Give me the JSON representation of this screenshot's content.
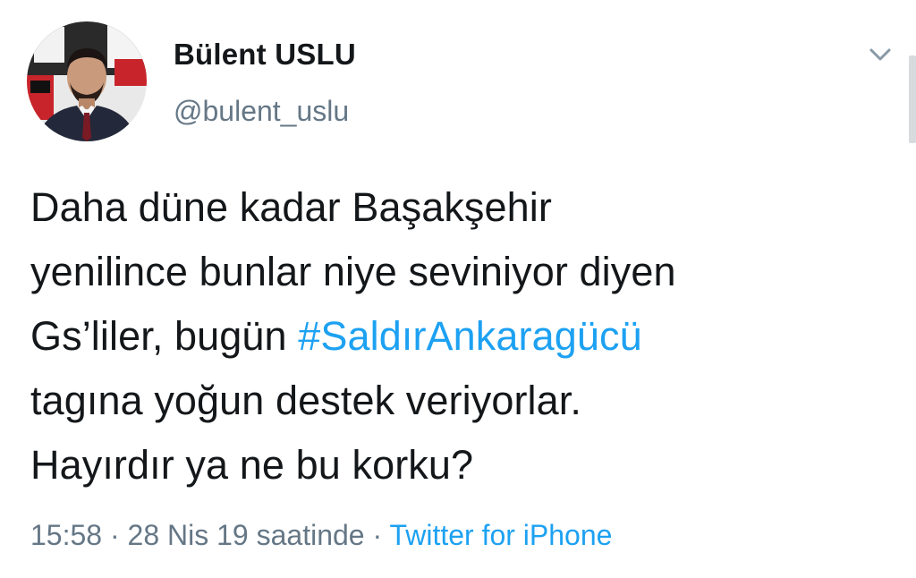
{
  "user": {
    "display_name": "Bülent USLU",
    "handle": "@bulent_uslu"
  },
  "tweet": {
    "line1": "Daha düne kadar Başakşehir",
    "line2": "yenilince bunlar niye seviniyor diyen",
    "line3_prefix": "Gs’liler, bugün ",
    "hashtag": "#SaldırAnkaragücü",
    "line4": "tagına yoğun destek veriyorlar.",
    "line5": "Hayırdır ya ne bu korku?"
  },
  "meta": {
    "time": "15:58",
    "separator1": " · ",
    "date": "28 Nis 19 saatinde",
    "separator2": " · ",
    "source": "Twitter for iPhone"
  },
  "icons": {
    "caret": "chevron-down-icon",
    "avatar": "profile-photo"
  },
  "colors": {
    "text": "#14171a",
    "secondary": "#657786",
    "link": "#1da1f2"
  }
}
